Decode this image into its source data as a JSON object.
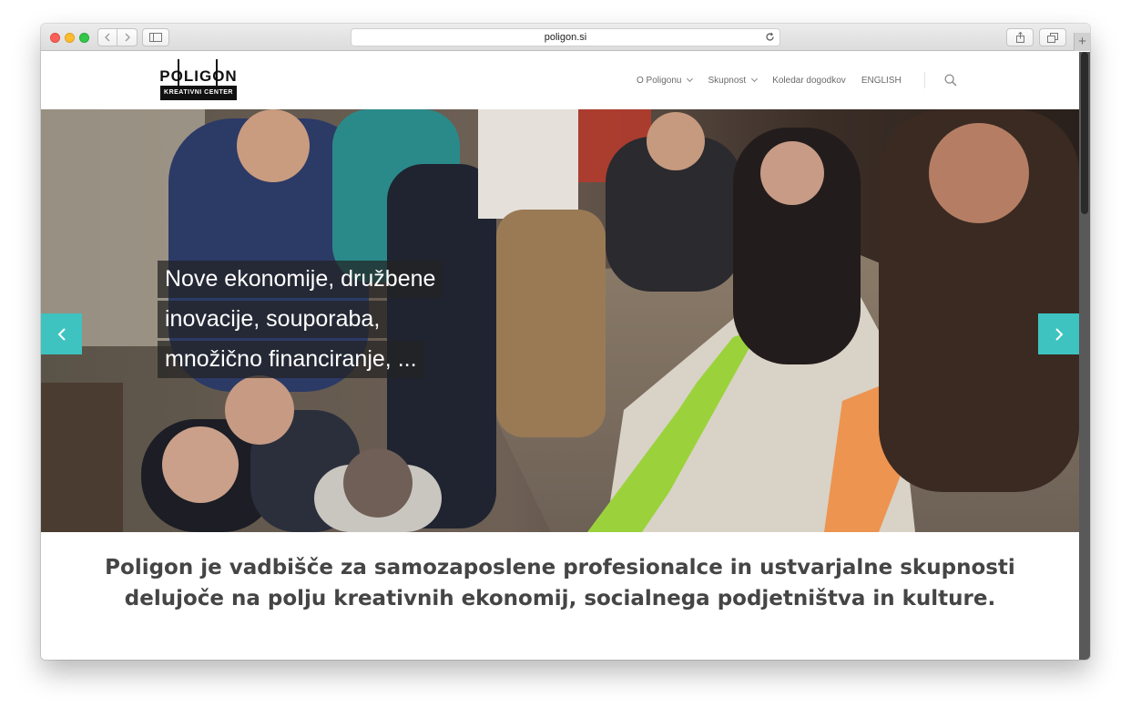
{
  "browser": {
    "url": "poligon.si"
  },
  "site": {
    "logo": {
      "word": "POLIGON",
      "subtitle": "KREATIVNI CENTER"
    },
    "nav": [
      {
        "label": "O Poligonu",
        "has_dropdown": true
      },
      {
        "label": "Skupnost",
        "has_dropdown": true
      },
      {
        "label": "Koledar dogodkov",
        "has_dropdown": false
      },
      {
        "label": "ENGLISH",
        "has_dropdown": false
      }
    ]
  },
  "hero": {
    "lines": [
      "Nove ekonomije, družbene",
      "inovacije, souporaba,",
      "množično financiranje, ..."
    ],
    "accent_color": "#3ec3c0"
  },
  "tagline": {
    "line1": "Poligon je vadbišče za samozaposlene profesionalce in ustvarjalne skupnosti",
    "line2": "delujoče na polju kreativnih ekonomij, socialnega podjetništva in kulture."
  }
}
